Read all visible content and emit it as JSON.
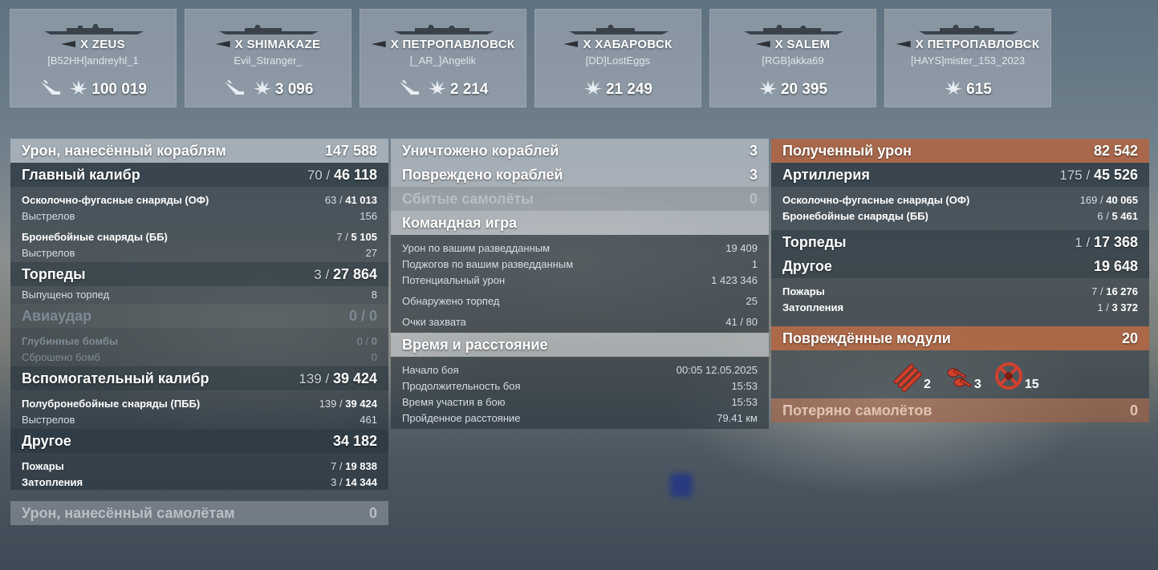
{
  "colors": {
    "accent_orange": "#b8623a",
    "panel_dark": "#28343e",
    "panel_light": "#cdd4da"
  },
  "ships": [
    {
      "name": "X ZEUS",
      "player": "[B52HH]andreyhl_1",
      "stat1": "",
      "stat2": "100 019",
      "icons": [
        "torpedo-hit-icon",
        "spotting-damage-icon"
      ]
    },
    {
      "name": "X SHIMAKAZE",
      "player": "Evil_Stranger_",
      "stat1": "",
      "stat2": "3 096",
      "icons": [
        "torpedo-hit-icon",
        "spotting-damage-icon"
      ]
    },
    {
      "name": "X ПЕТРОПАВЛОВСК",
      "player": "[_AR_]Angelik",
      "stat1": "",
      "stat2": "2 214",
      "icons": [
        "torpedo-hit-icon",
        "spotting-damage-icon"
      ]
    },
    {
      "name": "X ХАБАРОВСК",
      "player": "[DD]LostEggs",
      "stat1": "",
      "stat2": "21 249",
      "icons": [
        "spotting-damage-icon"
      ]
    },
    {
      "name": "X SALEM",
      "player": "[RGB]akka69",
      "stat1": "",
      "stat2": "20 395",
      "icons": [
        "spotting-damage-icon"
      ]
    },
    {
      "name": "X ПЕТРОПАВЛОВСК",
      "player": "[HAYS]mister_153_2023",
      "stat1": "",
      "stat2": "615",
      "icons": [
        "spotting-damage-icon"
      ]
    }
  ],
  "left": {
    "damage_title": "Урон, нанесённый кораблям",
    "damage_total": "147 588",
    "main_caliber": "Главный калибр",
    "main_hits": "70",
    "main_dmg": "46 118",
    "he": "Осколочно-фугасные снаряды (ОФ)",
    "he_hits": "63",
    "he_dmg": "41 013",
    "he_shots_label": "Выстрелов",
    "he_shots": "156",
    "ap": "Бронебойные снаряды (ББ)",
    "ap_hits": "7",
    "ap_dmg": "5 105",
    "ap_shots_label": "Выстрелов",
    "ap_shots": "27",
    "torpedoes": "Торпеды",
    "torp_hits": "3",
    "torp_dmg": "27 864",
    "torp_launched_label": "Выпущено торпед",
    "torp_launched": "8",
    "airstrike": "Авиаудар",
    "air_hits": "0",
    "air_dmg": "0",
    "depth": "Глубинные бомбы",
    "depth_hits": "0",
    "depth_dmg": "0",
    "bombs_label": "Сброшено бомб",
    "bombs": "0",
    "secondary": "Вспомогательный калибр",
    "sec_hits": "139",
    "sec_dmg": "39 424",
    "sap": "Полубронебойные снаряды (ПББ)",
    "sap_hits": "139",
    "sap_dmg": "39 424",
    "sap_shots_label": "Выстрелов",
    "sap_shots": "461",
    "other": "Другое",
    "other_dmg": "34 182",
    "fires": "Пожары",
    "fires_n": "7",
    "fires_dmg": "19 838",
    "floods": "Затопления",
    "floods_n": "3",
    "floods_dmg": "14 344",
    "planes_dmg_title": "Урон, нанесённый самолётам",
    "planes_dmg": "0"
  },
  "mid": {
    "destroyed": "Уничтожено кораблей",
    "destroyed_n": "3",
    "damaged": "Повреждено кораблей",
    "damaged_n": "3",
    "planes": "Сбитые самолёты",
    "planes_n": "0",
    "team": "Командная игра",
    "spot_dmg": "Урон по вашим разведданным",
    "spot_dmg_v": "19 409",
    "spot_fires": "Поджогов по вашим разведданным",
    "spot_fires_v": "1",
    "potential": "Потенциальный урон",
    "potential_v": "1 423 346",
    "torp_spotted": "Обнаружено торпед",
    "torp_spotted_v": "25",
    "capture": "Очки захвата",
    "capture_v": "41 / 80",
    "time_title": "Время и расстояние",
    "start": "Начало боя",
    "start_v": "00:05  12.05.2025",
    "duration": "Продолжительность боя",
    "duration_v": "15:53",
    "participation": "Время участия в бою",
    "participation_v": "15:53",
    "distance": "Пройденное расстояние",
    "distance_v": "79.41 км"
  },
  "right": {
    "received": "Полученный урон",
    "received_v": "82 542",
    "artillery": "Артиллерия",
    "art_hits": "175",
    "art_dmg": "45 526",
    "he": "Осколочно-фугасные снаряды (ОФ)",
    "he_hits": "169",
    "he_dmg": "40 065",
    "ap": "Бронебойные снаряды (ББ)",
    "ap_hits": "6",
    "ap_dmg": "5 461",
    "torpedoes": "Торпеды",
    "torp_hits": "1",
    "torp_dmg": "17 368",
    "other": "Другое",
    "other_dmg": "19 648",
    "fires": "Пожары",
    "fires_n": "7",
    "fires_dmg": "16 276",
    "floods": "Затопления",
    "floods_n": "1",
    "floods_dmg": "3 372",
    "modules": "Повреждённые модули",
    "modules_v": "20",
    "module_icons": [
      {
        "icon": "torpedo-tube-icon",
        "count": "2"
      },
      {
        "icon": "gun-turret-icon",
        "count": "3"
      },
      {
        "icon": "aa-mount-icon",
        "count": "15"
      }
    ],
    "planes_lost": "Потеряно самолётов",
    "planes_lost_v": "0"
  }
}
